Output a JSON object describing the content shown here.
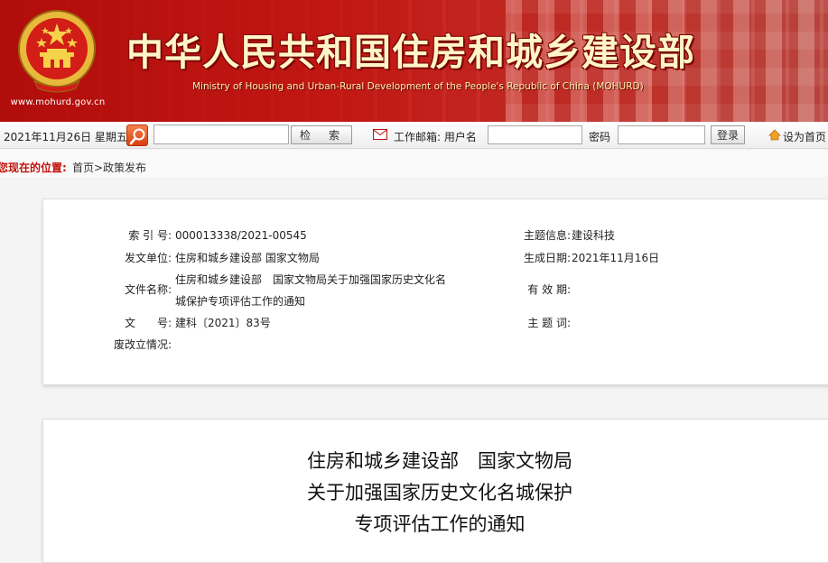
{
  "header": {
    "site_url": "www.mohurd.gov.cn",
    "ministry_name_cn": "中华人民共和国住房和城乡建设部",
    "ministry_name_en": "Ministry of Housing and Urban-Rural Development of the People's Republic of China (MOHURD)",
    "brand_color": "#b3201b"
  },
  "toolbar": {
    "date": "2021年11月26日 星期五",
    "search_value": "",
    "search_button": "检　索",
    "mail_label": "工作邮箱: 用户名",
    "username_value": "",
    "password_label": "密码",
    "password_value": "",
    "login_button": "登录",
    "set_home_label": "设为首页"
  },
  "breadcrumb": {
    "label": "您现在的位置:",
    "path": "首页>政策发布"
  },
  "info": {
    "index_no_label": "索 引 号:",
    "index_no": "000013338/2021-00545",
    "topic_label": "主题信息:",
    "topic": "建设科技",
    "issuer_label": "发文单位:",
    "issuer": "住房和城乡建设部 国家文物局",
    "date_label": "生成日期:",
    "date": "2021年11月16日",
    "doc_name_label": "文件名称:",
    "doc_name_line1": "住房和城乡建设部　国家文物局关于加强国家历史文化名",
    "doc_name_line2": "城保护专项评估工作的通知",
    "validity_label": "有 效 期:",
    "validity": "",
    "doc_no_label": "文　　号:",
    "doc_no": "建科〔2021〕83号",
    "keywords_label": "主 题 词:",
    "keywords": "",
    "status_label": "废改立情况:",
    "status": ""
  },
  "document": {
    "title_line1": "住房和城乡建设部　国家文物局",
    "title_line2": "关于加强国家历史文化名城保护",
    "title_line3": "专项评估工作的通知"
  }
}
